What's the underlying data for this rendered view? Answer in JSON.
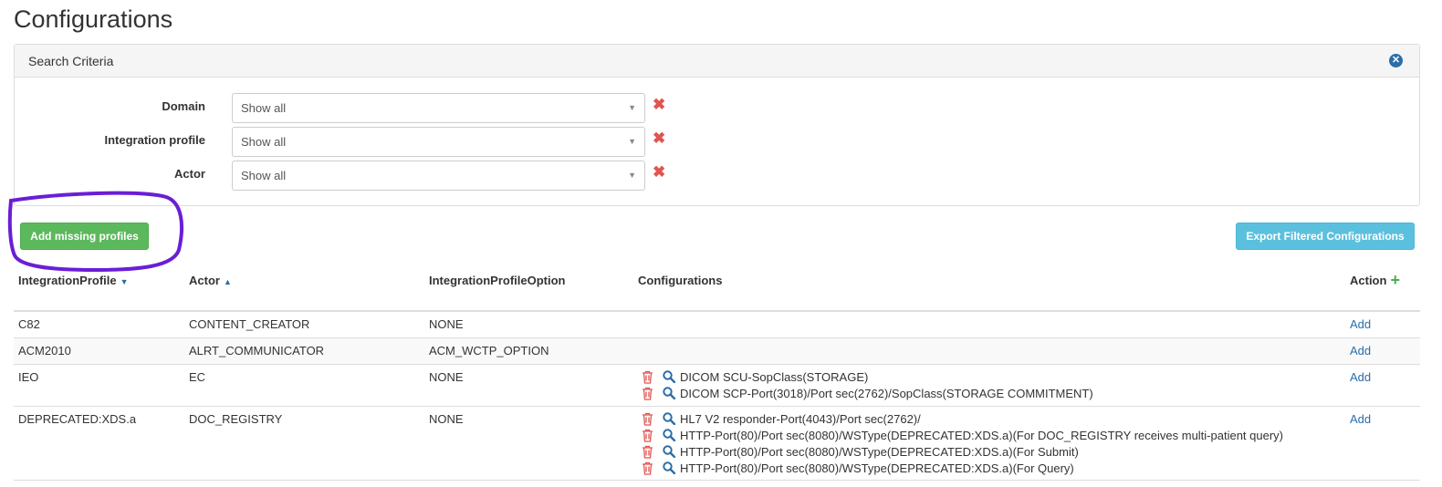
{
  "page": {
    "title": "Configurations"
  },
  "search": {
    "title": "Search Criteria",
    "filters": [
      {
        "label": "Domain",
        "value": "Show all"
      },
      {
        "label": "Integration profile",
        "value": "Show all"
      },
      {
        "label": "Actor",
        "value": "Show all"
      }
    ]
  },
  "buttons": {
    "add_missing": "Add missing profiles",
    "export": "Export Filtered Configurations"
  },
  "table": {
    "headers": {
      "integration_profile": "IntegrationProfile",
      "actor": "Actor",
      "option": "IntegrationProfileOption",
      "configurations": "Configurations",
      "action": "Action"
    },
    "rows": [
      {
        "profile": "C82",
        "actor": "CONTENT_CREATOR",
        "option": "NONE",
        "configurations": [],
        "action": "Add"
      },
      {
        "profile": "ACM2010",
        "actor": "ALRT_COMMUNICATOR",
        "option": "ACM_WCTP_OPTION",
        "configurations": [],
        "action": "Add"
      },
      {
        "profile": "IEO",
        "actor": "EC",
        "option": "NONE",
        "configurations": [
          "DICOM SCU-SopClass(STORAGE)",
          "DICOM SCP-Port(3018)/Port sec(2762)/SopClass(STORAGE COMMITMENT)"
        ],
        "action": "Add"
      },
      {
        "profile": "DEPRECATED:XDS.a",
        "actor": "DOC_REGISTRY",
        "option": "NONE",
        "configurations": [
          "HL7 V2 responder-Port(4043)/Port sec(2762)/",
          "HTTP-Port(80)/Port sec(8080)/WSType(DEPRECATED:XDS.a)(For DOC_REGISTRY receives multi-patient query)",
          "HTTP-Port(80)/Port sec(8080)/WSType(DEPRECATED:XDS.a)(For Submit)",
          "HTTP-Port(80)/Port sec(8080)/WSType(DEPRECATED:XDS.a)(For Query)"
        ],
        "action": "Add"
      }
    ]
  },
  "colors": {
    "green": "#5cb85c",
    "blue": "#5bc0de",
    "link": "#2a6ea8",
    "danger": "#e05550",
    "annotation": "#6a1ed6"
  },
  "icons": {
    "collapse": "close-circle-icon",
    "clear": "x-icon",
    "sort": "sort-icon",
    "add": "plus-icon",
    "delete": "trash-icon",
    "view": "magnifier-icon"
  }
}
